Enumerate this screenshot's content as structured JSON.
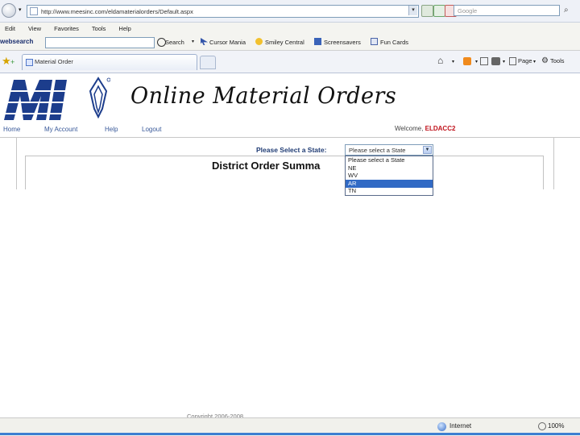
{
  "browser": {
    "address": "http://www.meesinc.com/eldamaterialorders/Default.aspx",
    "search_placeholder": "Google",
    "menu": [
      "Edit",
      "View",
      "Favorites",
      "Tools",
      "Help"
    ],
    "webs": {
      "brand": "websearch",
      "search_button": "Search",
      "items": [
        "Cursor Mania",
        "Smiley Central",
        "Screensavers",
        "Fun Cards"
      ]
    },
    "tab_title": "Material Order",
    "commands": [
      "Page",
      "Tools"
    ],
    "status_zone": "Internet",
    "zoom": "100%"
  },
  "page": {
    "logo_text": "MI",
    "title": "Online Material Orders",
    "nav": [
      "Home",
      "My Account",
      "Help",
      "Logout"
    ],
    "welcome_label": "Welcome,",
    "welcome_user": "ELDACC2",
    "state_label": "Please Select a State:",
    "state_selected": "Please select a State",
    "state_options": [
      "Please select a State",
      "NE",
      "WV",
      "AR",
      "TN"
    ],
    "state_highlighted": "AR",
    "summary_title": "District Order Summa",
    "footer_partial": "Copyright 2006-2008 ..."
  },
  "colors": {
    "brand_blue": "#1c3d8c",
    "selection": "#316ac5",
    "welcome_user": "#c0121b"
  }
}
